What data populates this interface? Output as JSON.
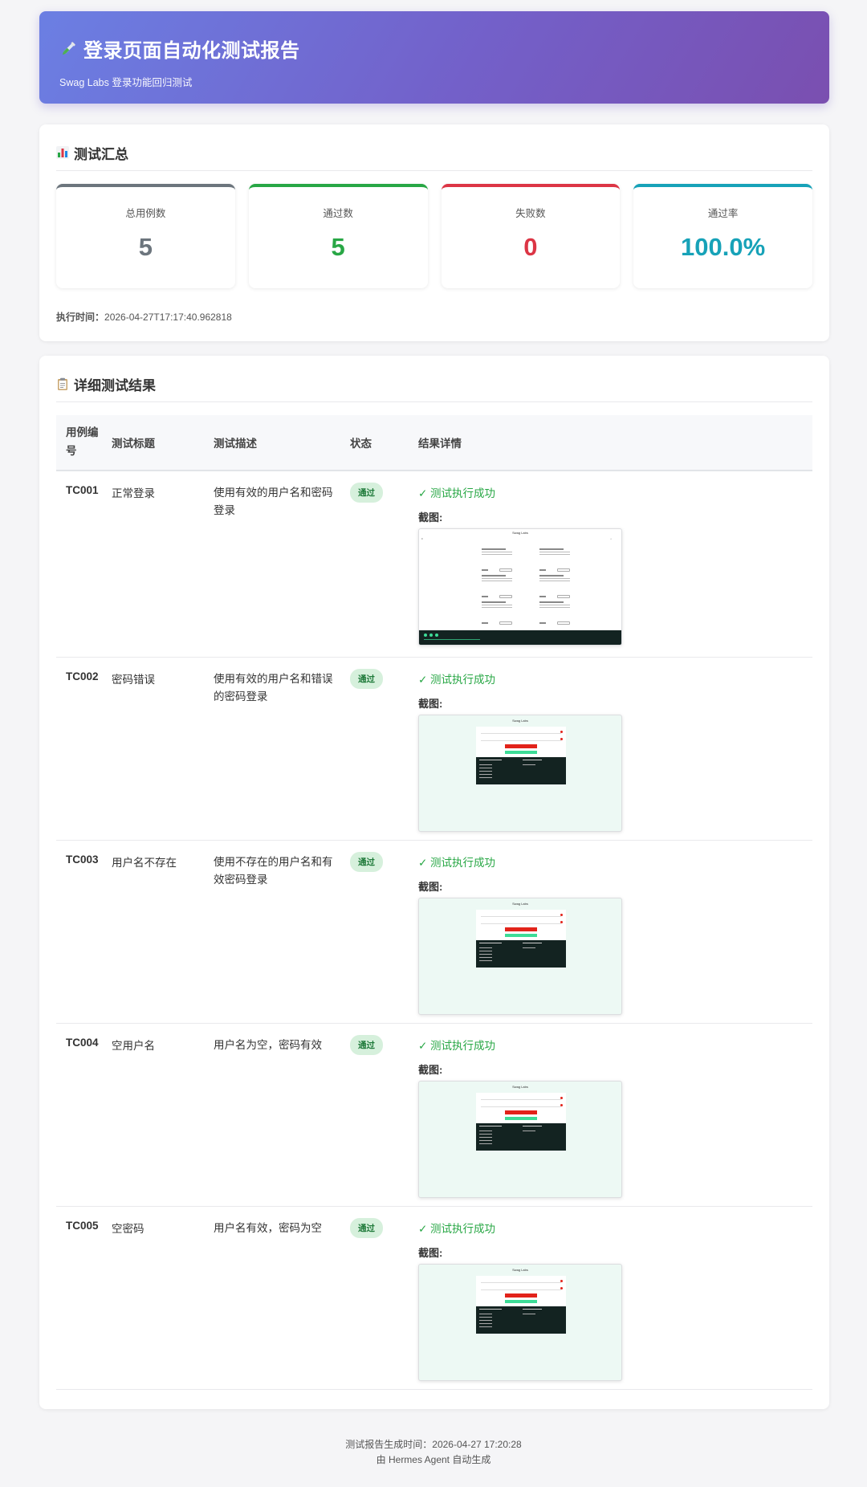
{
  "header": {
    "title": "登录页面自动化测试报告",
    "subtitle": "Swag Labs 登录功能回归测试",
    "icon": "test-tube-icon"
  },
  "summary": {
    "section_title": "测试汇总",
    "icon": "bar-chart-icon",
    "stats": [
      {
        "label": "总用例数",
        "value": "5",
        "color": "#6c757d"
      },
      {
        "label": "通过数",
        "value": "5",
        "color": "#28a745"
      },
      {
        "label": "失败数",
        "value": "0",
        "color": "#dc3545"
      },
      {
        "label": "通过率",
        "value": "100.0%",
        "color": "#17a2b8"
      }
    ],
    "exec_time_label": "执行时间：",
    "exec_time": "2026-04-27T17:17:40.962818"
  },
  "details": {
    "section_title": "详细测试结果",
    "icon": "clipboard-icon",
    "columns": {
      "id": "用例编号",
      "title": "测试标题",
      "desc": "测试描述",
      "status": "状态",
      "result": "结果详情"
    },
    "screenshot_label": "截图:",
    "screenshot_app_title": "Swag Labs",
    "rows": [
      {
        "id": "TC001",
        "title": "正常登录",
        "desc": "使用有效的用户名和密码登录",
        "status": "通过",
        "result": "✓ 测试执行成功"
      },
      {
        "id": "TC002",
        "title": "密码错误",
        "desc": "使用有效的用户名和错误的密码登录",
        "status": "通过",
        "result": "✓ 测试执行成功"
      },
      {
        "id": "TC003",
        "title": "用户名不存在",
        "desc": "使用不存在的用户名和有效密码登录",
        "status": "通过",
        "result": "✓ 测试执行成功"
      },
      {
        "id": "TC004",
        "title": "空用户名",
        "desc": "用户名为空，密码有效",
        "status": "通过",
        "result": "✓ 测试执行成功"
      },
      {
        "id": "TC005",
        "title": "空密码",
        "desc": "用户名有效，密码为空",
        "status": "通过",
        "result": "✓ 测试执行成功"
      }
    ]
  },
  "footer": {
    "generated_label": "测试报告生成时间：",
    "generated_time": "2026-04-27 17:20:28",
    "credit": "由 Hermes Agent 自动生成"
  }
}
